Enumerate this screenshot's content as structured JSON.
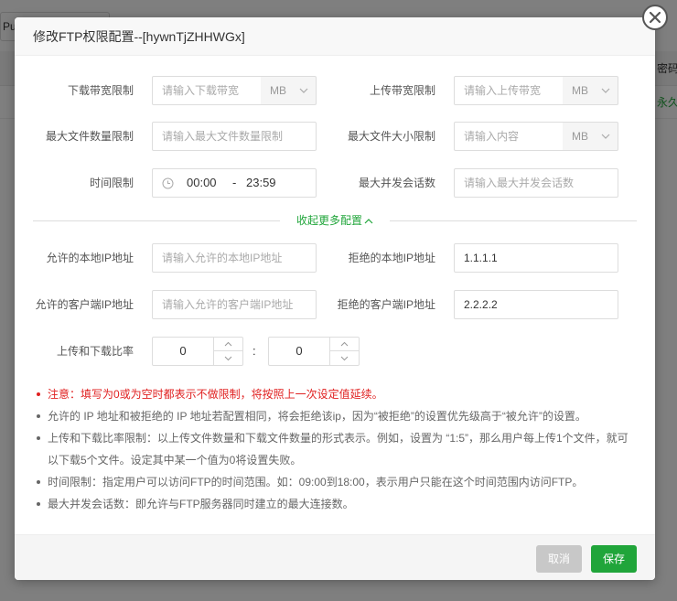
{
  "background": {
    "button_label": "Pu",
    "table_header_partial": "密码",
    "table_row_partial": "永久"
  },
  "dialog": {
    "title": "修改FTP权限配置--[hywnTjZHHWGx]",
    "fields": {
      "download_limit": {
        "label": "下载带宽限制",
        "placeholder": "请输入下载带宽",
        "unit": "MB"
      },
      "upload_limit": {
        "label": "上传带宽限制",
        "placeholder": "请输入上传带宽",
        "unit": "MB"
      },
      "max_files": {
        "label": "最大文件数量限制",
        "placeholder": "请输入最大文件数量限制"
      },
      "max_file_size": {
        "label": "最大文件大小限制",
        "placeholder": "请输入内容",
        "unit": "MB"
      },
      "time_limit": {
        "label": "时间限制",
        "start": "00:00",
        "separator": "-",
        "end": "23:59"
      },
      "max_sessions": {
        "label": "最大并发会话数",
        "placeholder": "请输入最大并发会话数"
      },
      "allow_local_ip": {
        "label": "允许的本地IP地址",
        "placeholder": "请输入允许的本地IP地址"
      },
      "deny_local_ip": {
        "label": "拒绝的本地IP地址",
        "value": "1.1.1.1"
      },
      "allow_client_ip": {
        "label": "允许的客户端IP地址",
        "placeholder": "请输入允许的客户端IP地址"
      },
      "deny_client_ip": {
        "label": "拒绝的客户端IP地址",
        "value": "2.2.2.2"
      },
      "ratio": {
        "label": "上传和下载比率",
        "upload": "0",
        "separator": ":",
        "download": "0"
      }
    },
    "toggle_label": "收起更多配置",
    "notes": [
      "注意：填写为0或为空时都表示不做限制，将按照上一次设定值延续。",
      "允许的 IP 地址和被拒绝的 IP 地址若配置相同，将会拒绝该ip，因为“被拒绝”的设置优先级高于“被允许”的设置。",
      "上传和下载比率限制：以上传文件数量和下载文件数量的形式表示。例如，设置为 “1:5”，那么用户每上传1个文件，就可",
      "以下载5个文件。设定其中某一个值为0将设置失败。",
      "时间限制：指定用户可以访问FTP的时间范围。如：09:00到18:00，表示用户只能在这个时间范围内访问FTP。",
      "最大并发会话数：即允许与FTP服务器同时建立的最大连接数。"
    ],
    "buttons": {
      "cancel": "取消",
      "save": "保存"
    }
  },
  "colors": {
    "accent": "#20a53a",
    "warning": "#e02020",
    "cancel_bg": "#c8c8c8"
  }
}
